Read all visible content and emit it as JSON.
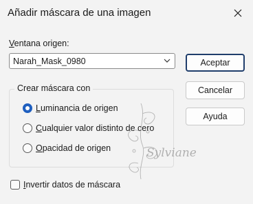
{
  "window": {
    "title": "Añadir máscara de una imagen",
    "close_icon": "close-icon"
  },
  "source": {
    "label_mnemonic": "V",
    "label_rest": "entana origen:",
    "selected_value": "Narah_Mask_0980",
    "dropdown_icon": "chevron-down-icon"
  },
  "buttons": {
    "accept": "Aceptar",
    "cancel": "Cancelar",
    "help": "Ayuda"
  },
  "create_group": {
    "legend": "Crear máscara con",
    "options": [
      {
        "mnemonic": "L",
        "rest": "uminancia de origen",
        "checked": true
      },
      {
        "mnemonic": "C",
        "rest": "ualquier valor distinto de cero",
        "checked": false
      },
      {
        "mnemonic": "O",
        "rest": "pacidad de origen",
        "checked": false
      }
    ]
  },
  "invert": {
    "mnemonic": "I",
    "rest": "nvertir datos de máscara",
    "checked": false
  },
  "watermark": {
    "text": "Sylviane"
  },
  "colors": {
    "background": "#f3f3f3",
    "accent": "#1f5fbf",
    "primary_border": "#1f3d6b"
  }
}
